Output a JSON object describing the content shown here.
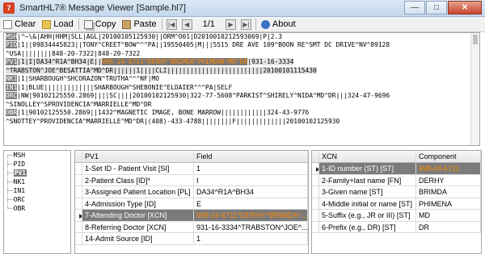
{
  "window": {
    "logo": "7",
    "title": "SmartHL7® Message Viewer [Sample.hl7]"
  },
  "toolbar": {
    "clear": "Clear",
    "load": "Load",
    "copy": "Copy",
    "paste": "Paste",
    "page": "1/1",
    "about": "About"
  },
  "message_lines": [
    [
      {
        "t": "MSH",
        "c": "seg"
      },
      {
        "t": "|^~\\&|AHH|HHM|SLL|AGL|20100105125930||ORM^O01|D2010010212593069|P|2.3"
      }
    ],
    [
      {
        "t": "PID",
        "c": "seg"
      },
      {
        "t": "|1||09834445823||TONY^CREET^BOW^^^PA||19550405|M|||5515 DRE AVE 109^BOON RE^SMT DC DRIVE^NV^89128"
      }
    ],
    [
      {
        "t": "^USA||||||||848-20-7322|848-20-7322"
      }
    ],
    [
      {
        "t": "PV1",
        "c": "seg"
      },
      {
        "t": "|1|I|DA34^R1A^BH34|E||",
        "c": "row"
      },
      {
        "t": "998-24-6711^DERHY^BRIMDA^PHIMENA^MD^DR",
        "c": "hl"
      },
      {
        "t": "|931-16-3334",
        "c": "row"
      }
    ],
    [
      {
        "t": "^TRABSTON^JOE^BESATTIA^MD^DR||||||1||||CLI|||||||||||||||||||||||||20100101115430",
        "c": "row"
      }
    ],
    [
      {
        "t": "NK1",
        "c": "seg"
      },
      {
        "t": "|1|SHARBOUGH^SHCORAZON^TRUTHA^^^NF|MO"
      }
    ],
    [
      {
        "t": "IN1",
        "c": "seg"
      },
      {
        "t": "|1|BLUE|||||||||||||SHARBOUGH^SHEBONIE^ELDAIER^^^PA|SELF"
      }
    ],
    [
      {
        "t": "ORC",
        "c": "seg"
      },
      {
        "t": "|NW|90102125550.2869||||SC||||20100102125930|322-77-5608^PARKIST^SHIRELY^NIDA^MD^DR|||324-47-9696"
      }
    ],
    [
      {
        "t": "^SINOLLEY^SPROVIDENCIA^MARRIELLE^MD^DR"
      }
    ],
    [
      {
        "t": "OBR",
        "c": "seg"
      },
      {
        "t": "|1|90102125550.2869||1432^MAGNETIC IMAGE, BONE MARROW||||||||||||324-43-9776"
      }
    ],
    [
      {
        "t": "^SNOTTEY^PROVIDENCIA^MARRIELLE^MD^DR|(408)-433-4788||||||||F|||||||||||||20100102125930"
      }
    ]
  ],
  "tree": {
    "items": [
      "MSH",
      "PID",
      "PV1",
      "NK1",
      "IN1",
      "ORC",
      "OBR"
    ],
    "selected": "PV1"
  },
  "field_grid": {
    "headers": [
      "",
      "PV1",
      "Field"
    ],
    "rows": [
      [
        "1-Set ID - Patient Visit [SI]",
        "1"
      ],
      [
        "2-Patient Class [ID]*",
        "I"
      ],
      [
        "3-Assigned Patient Location [PL]",
        "DA34^R1A^BH34"
      ],
      [
        "4-Admission Type [ID]",
        "E"
      ],
      [
        "7-Attending Doctor [XCN]",
        "998-24-6711^DERHY^BRIMDA^..."
      ],
      [
        "8-Referring Doctor [XCN]",
        "931-16-3334^TRABSTON^JOE^..."
      ],
      [
        "14-Admit Source [ID]",
        "1"
      ]
    ],
    "selected_index": 4
  },
  "component_grid": {
    "headers": [
      "",
      "XCN",
      "Component"
    ],
    "rows": [
      [
        "1-ID number (ST) [ST]",
        "998-24-6711"
      ],
      [
        "2-Family+last name [FN]",
        "DERHY"
      ],
      [
        "3-Given name [ST]",
        "BRIMDA"
      ],
      [
        "4-Middle initial or name [ST]",
        "PHIMENA"
      ],
      [
        "5-Suffix (e.g., JR or III) [ST]",
        "MD"
      ],
      [
        "6-Prefix (e.g., DR) [ST]",
        "DR"
      ]
    ],
    "selected_index": 0
  }
}
